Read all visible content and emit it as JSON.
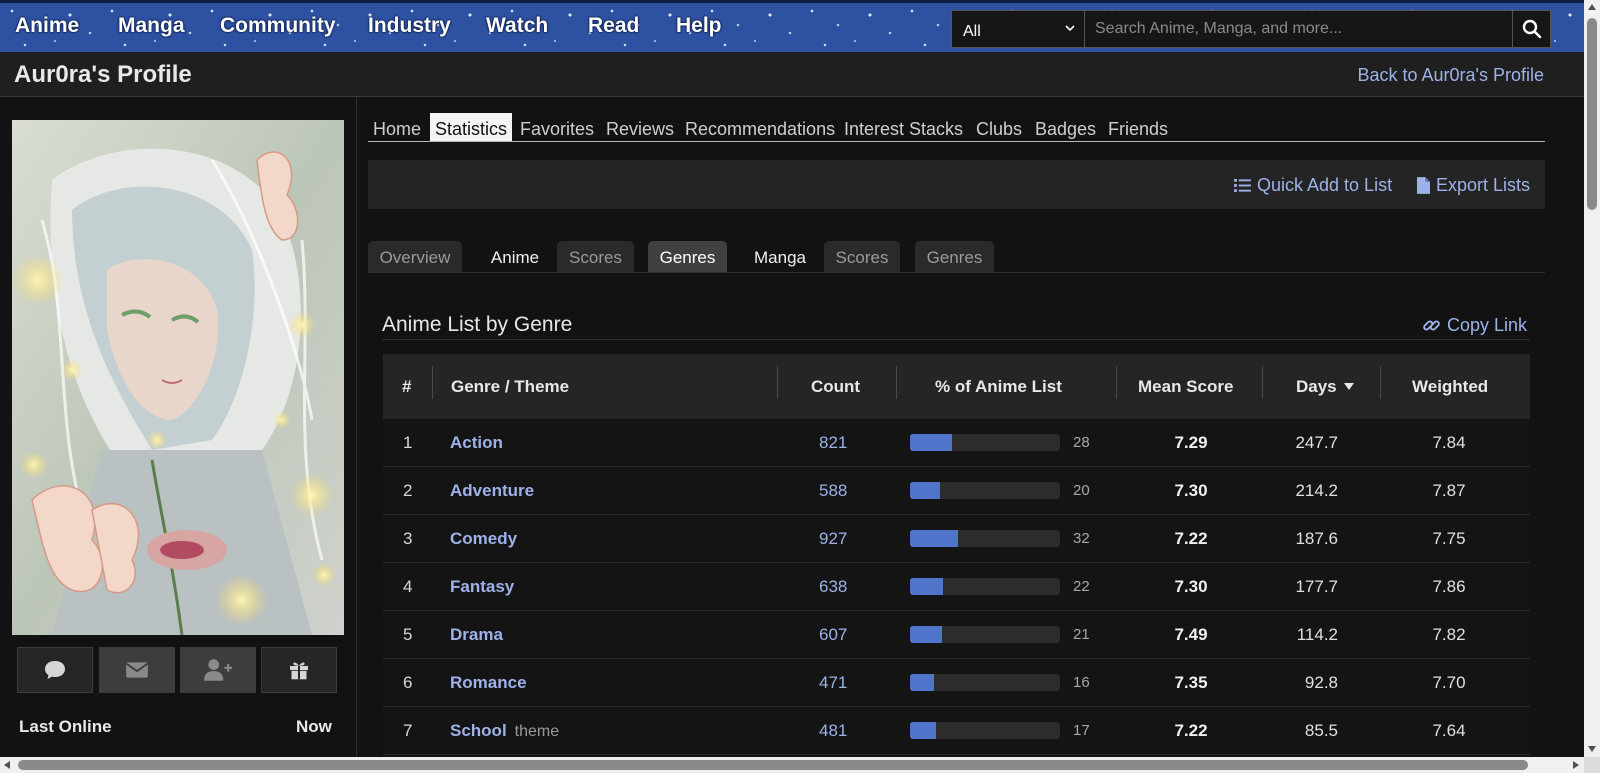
{
  "topnav": {
    "items": [
      "Anime",
      "Manga",
      "Community",
      "Industry",
      "Watch",
      "Read",
      "Help"
    ],
    "search_category": "All",
    "search_placeholder": "Search Anime, Manga, and more..."
  },
  "header": {
    "title": "Aur0ra's Profile",
    "back_link": "Back to Aur0ra's Profile"
  },
  "profile_tabs": [
    "Home",
    "Statistics",
    "Favorites",
    "Reviews",
    "Recommendations",
    "Interest Stacks",
    "Clubs",
    "Badges",
    "Friends"
  ],
  "active_profile_tab": "Statistics",
  "toolbar": {
    "quick_add": "Quick Add to List",
    "export": "Export Lists"
  },
  "stat_tabs": {
    "overview": "Overview",
    "anime_label": "Anime",
    "anime_scores": "Scores",
    "anime_genres": "Genres",
    "manga_label": "Manga",
    "manga_scores": "Scores",
    "manga_genres": "Genres",
    "active": "Genres (Anime)"
  },
  "sidebar": {
    "last_online_label": "Last Online",
    "last_online_value": "Now",
    "action_icons": [
      "comment-icon",
      "envelope-icon",
      "user-plus-icon",
      "gift-icon"
    ]
  },
  "section": {
    "title": "Anime List by Genre",
    "copy_link": "Copy Link"
  },
  "table": {
    "headers": {
      "rank": "#",
      "genre": "Genre / Theme",
      "count": "Count",
      "percent": "% of Anime List",
      "mean": "Mean Score",
      "days": "Days",
      "weighted": "Weighted"
    },
    "sorted_by": "Days",
    "rows": [
      {
        "rank": "1",
        "genre": "Action",
        "theme": "",
        "count": "821",
        "percent": 28,
        "percent_text": "28",
        "mean": "7.29",
        "days": "247.7",
        "weighted": "7.84"
      },
      {
        "rank": "2",
        "genre": "Adventure",
        "theme": "",
        "count": "588",
        "percent": 20,
        "percent_text": "20",
        "mean": "7.30",
        "days": "214.2",
        "weighted": "7.87"
      },
      {
        "rank": "3",
        "genre": "Comedy",
        "theme": "",
        "count": "927",
        "percent": 32,
        "percent_text": "32",
        "mean": "7.22",
        "days": "187.6",
        "weighted": "7.75"
      },
      {
        "rank": "4",
        "genre": "Fantasy",
        "theme": "",
        "count": "638",
        "percent": 22,
        "percent_text": "22",
        "mean": "7.30",
        "days": "177.7",
        "weighted": "7.86"
      },
      {
        "rank": "5",
        "genre": "Drama",
        "theme": "",
        "count": "607",
        "percent": 21,
        "percent_text": "21",
        "mean": "7.49",
        "days": "114.2",
        "weighted": "7.82"
      },
      {
        "rank": "6",
        "genre": "Romance",
        "theme": "",
        "count": "471",
        "percent": 16,
        "percent_text": "16",
        "mean": "7.35",
        "days": "92.8",
        "weighted": "7.70"
      },
      {
        "rank": "7",
        "genre": "School",
        "theme": "theme",
        "count": "481",
        "percent": 17,
        "percent_text": "17",
        "mean": "7.22",
        "days": "85.5",
        "weighted": "7.64"
      }
    ]
  },
  "colors": {
    "nav_blue": "#2e51a2",
    "link": "#9db2e8",
    "bar": "#4f74c9",
    "background": "#121212"
  }
}
